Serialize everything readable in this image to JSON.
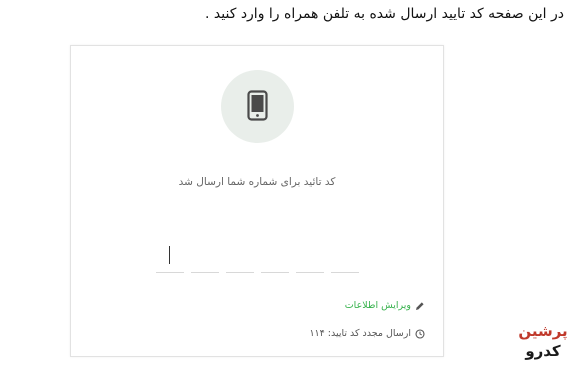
{
  "instruction": "در این صفحه کد تایید ارسال شده به تلفن همراه را وارد کنید .",
  "card": {
    "message": "کد تائید برای شماره شما ارسال شد",
    "code_boxes": 6,
    "edit_link": "ویرایش اطلاعات",
    "resend_text": "ارسال مجدد کد تایید: ۱۱۴"
  },
  "watermark": {
    "text": "پرشین کدرو"
  },
  "colors": {
    "accent_green": "#37b24d",
    "icon_circle": "#e9eeea"
  }
}
